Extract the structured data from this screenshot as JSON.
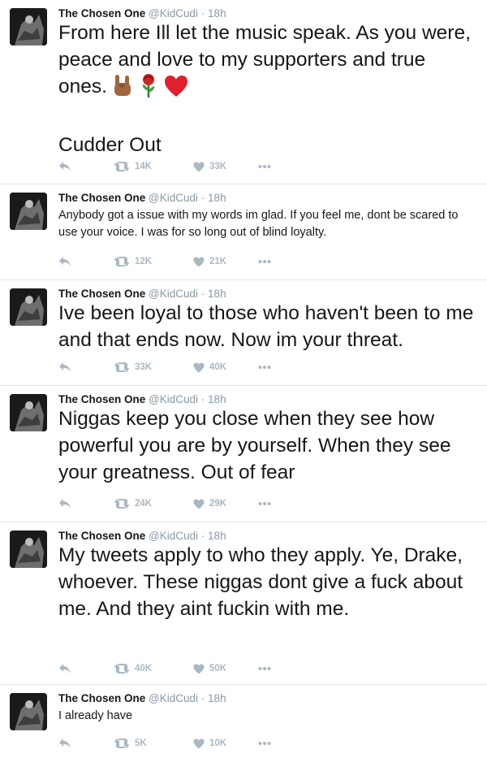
{
  "account": {
    "name": "The Chosen One",
    "handle": "@KidCudi",
    "separator": "·"
  },
  "tweets": [
    {
      "time": "18h",
      "text": "From here Ill let the music speak.  As you were, peace and love to my supporters and true ones.",
      "emojis": [
        "horns-hand-emoji",
        "rose-emoji",
        "red-heart-emoji"
      ],
      "text2": "Cudder Out",
      "retweets": "14K",
      "likes": "33K"
    },
    {
      "time": "18h",
      "text": "Anybody got a issue with my words im glad. If you feel me, dont be scared to use your voice. I was for so long out of blind loyalty.",
      "retweets": "12K",
      "likes": "21K"
    },
    {
      "time": "18h",
      "text": "Ive been loyal to those who haven't been to me and that ends now. Now im your threat.",
      "retweets": "33K",
      "likes": "40K"
    },
    {
      "time": "18h",
      "text": "Niggas keep you close when they see how powerful you are by yourself. When they see your greatness. Out of fear",
      "retweets": "24K",
      "likes": "29K"
    },
    {
      "time": "18h",
      "text": "My tweets apply to who they apply.  Ye, Drake, whoever. These niggas dont give a fuck about me. And they aint fuckin with me.",
      "retweets": "40K",
      "likes": "50K"
    },
    {
      "time": "18h",
      "text": "I already have",
      "retweets": "5K",
      "likes": "10K"
    }
  ],
  "colors": {
    "text": "#14171a",
    "muted": "#8899a6",
    "icon": "#aab8c2",
    "divider": "#e1e8ed"
  },
  "icons": [
    "reply-icon",
    "retweet-icon",
    "like-icon",
    "more-icon"
  ]
}
